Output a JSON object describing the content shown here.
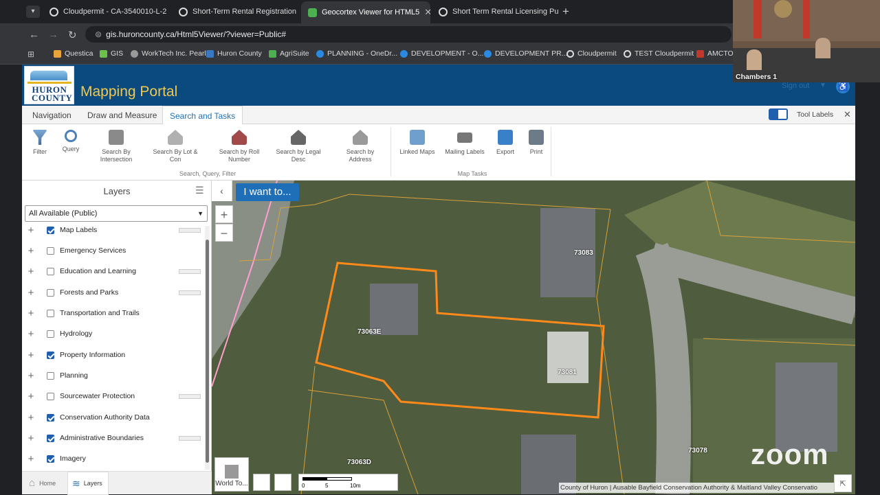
{
  "browser": {
    "tabs": [
      {
        "title": "Cloudpermit - CA-3540010-L-2"
      },
      {
        "title": "Short-Term Rental Registration"
      },
      {
        "title": "Geocortex Viewer for HTML5"
      },
      {
        "title": "Short Term Rental Licensing Pu"
      }
    ],
    "url": "gis.huroncounty.ca/Html5Viewer/?viewer=Public#",
    "bookmarks": [
      "Questica",
      "GIS",
      "WorkTech Inc. Pearl",
      "Huron County",
      "AgriSuite",
      "PLANNING - OneDr...",
      "DEVELOPMENT - O...",
      "DEVELOPMENT PR...",
      "Cloudpermit",
      "TEST Cloudpermit",
      "AMCTO"
    ]
  },
  "app": {
    "logo": "HURON COUNTY",
    "title": "Mapping Portal",
    "sign_out": "Sign out",
    "tool_labels": "Tool Labels",
    "ribbon_tabs": [
      "Navigation",
      "Draw and Measure",
      "Search and Tasks"
    ],
    "tools": [
      "Filter",
      "Query",
      "Search By Intersection",
      "Search By Lot & Con",
      "Search by Roll Number",
      "Search by Legal Desc",
      "Search by Address",
      "Linked Maps",
      "Mailing Labels",
      "Export",
      "Print"
    ],
    "groups": [
      "Search, Query, Filter",
      "Map Tasks"
    ]
  },
  "layers": {
    "title": "Layers",
    "dropdown": "All Available (Public)",
    "items": [
      {
        "label": "Map Labels",
        "checked": true
      },
      {
        "label": "Emergency Services",
        "checked": false
      },
      {
        "label": "Education and Learning",
        "checked": false
      },
      {
        "label": "Forests and Parks",
        "checked": false
      },
      {
        "label": "Transportation and Trails",
        "checked": false
      },
      {
        "label": "Hydrology",
        "checked": false
      },
      {
        "label": "Property Information",
        "checked": true
      },
      {
        "label": "Planning",
        "checked": false
      },
      {
        "label": "Sourcewater Protection",
        "checked": false
      },
      {
        "label": "Conservation Authority Data",
        "checked": true
      },
      {
        "label": "Administrative Boundaries",
        "checked": true
      },
      {
        "label": "Imagery",
        "checked": true
      }
    ],
    "footer": [
      "Home",
      "Layers"
    ]
  },
  "map": {
    "iwant": "I want to...",
    "zoom_in": "+",
    "zoom_out": "−",
    "parcels": [
      "73083",
      "73063E",
      "73081",
      "73063D",
      "73078"
    ],
    "basemap": "World To...",
    "scale": [
      "0",
      "5",
      "10m"
    ],
    "attribution": "County of Huron | Ausable Bayfield Conservation Authority & Maitland Valley Conservatio"
  },
  "zoom": {
    "participant": "Chambers 1",
    "logo": "zoom"
  }
}
